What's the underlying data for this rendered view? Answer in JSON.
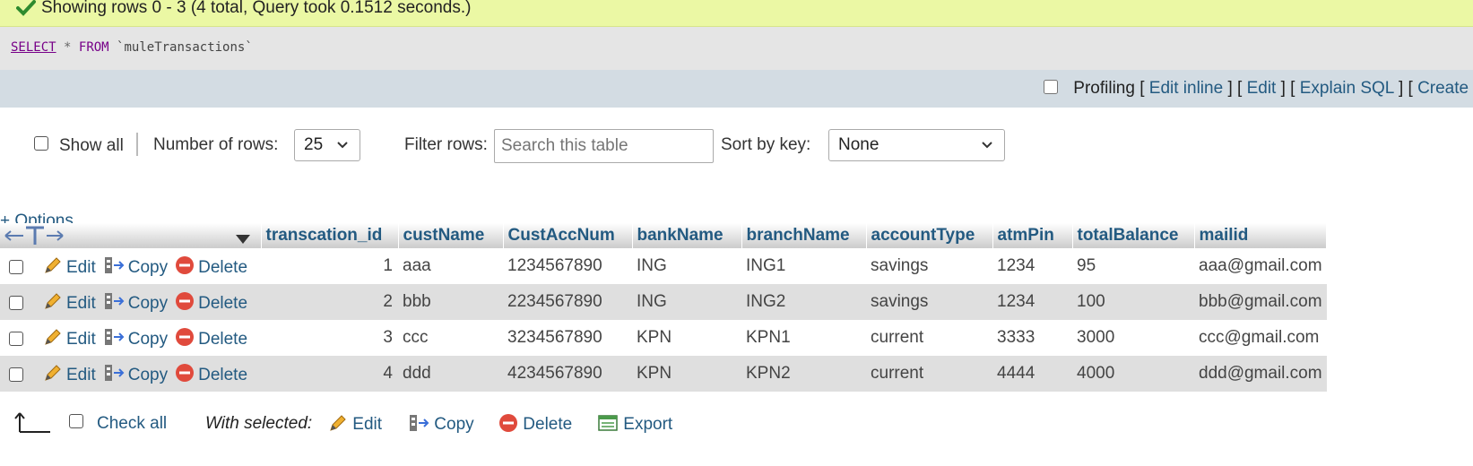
{
  "banner": {
    "message": "Showing rows 0 - 3 (4 total, Query took 0.1512 seconds.)"
  },
  "sql": {
    "select": "SELECT",
    "star": "*",
    "from": "FROM",
    "table": "`muleTransactions`"
  },
  "tools": {
    "profiling": "Profiling",
    "edit_inline": "Edit inline",
    "edit": "Edit",
    "explain": "Explain SQL",
    "create": "Create"
  },
  "nav": {
    "show_all": "Show all",
    "rows_label": "Number of rows:",
    "rows_value": "25",
    "filter_label": "Filter rows:",
    "filter_placeholder": "Search this table",
    "sort_label": "Sort by key:",
    "sort_value": "None"
  },
  "options": "+ Options",
  "columns": [
    "transcation_id",
    "custName",
    "CustAccNum",
    "bankName",
    "branchName",
    "accountType",
    "atmPin",
    "totalBalance",
    "mailid"
  ],
  "row_actions": {
    "edit": "Edit",
    "copy": "Copy",
    "delete": "Delete"
  },
  "rows": [
    [
      "1",
      "aaa",
      "1234567890",
      "ING",
      "ING1",
      "savings",
      "1234",
      "95",
      "aaa@gmail.com"
    ],
    [
      "2",
      "bbb",
      "2234567890",
      "ING",
      "ING2",
      "savings",
      "1234",
      "100",
      "bbb@gmail.com"
    ],
    [
      "3",
      "ccc",
      "3234567890",
      "KPN",
      "KPN1",
      "current",
      "3333",
      "3000",
      "ccc@gmail.com"
    ],
    [
      "4",
      "ddd",
      "4234567890",
      "KPN",
      "KPN2",
      "current",
      "4444",
      "4000",
      "ddd@gmail.com"
    ]
  ],
  "bottom": {
    "check_all": "Check all",
    "with_selected": "With selected:",
    "edit": "Edit",
    "copy": "Copy",
    "delete": "Delete",
    "export": "Export"
  },
  "colors": {
    "link": "#235a81",
    "banner": "#ebf8a4",
    "toolbar": "#d3dce3",
    "row_alt": "#dfdfdf"
  }
}
